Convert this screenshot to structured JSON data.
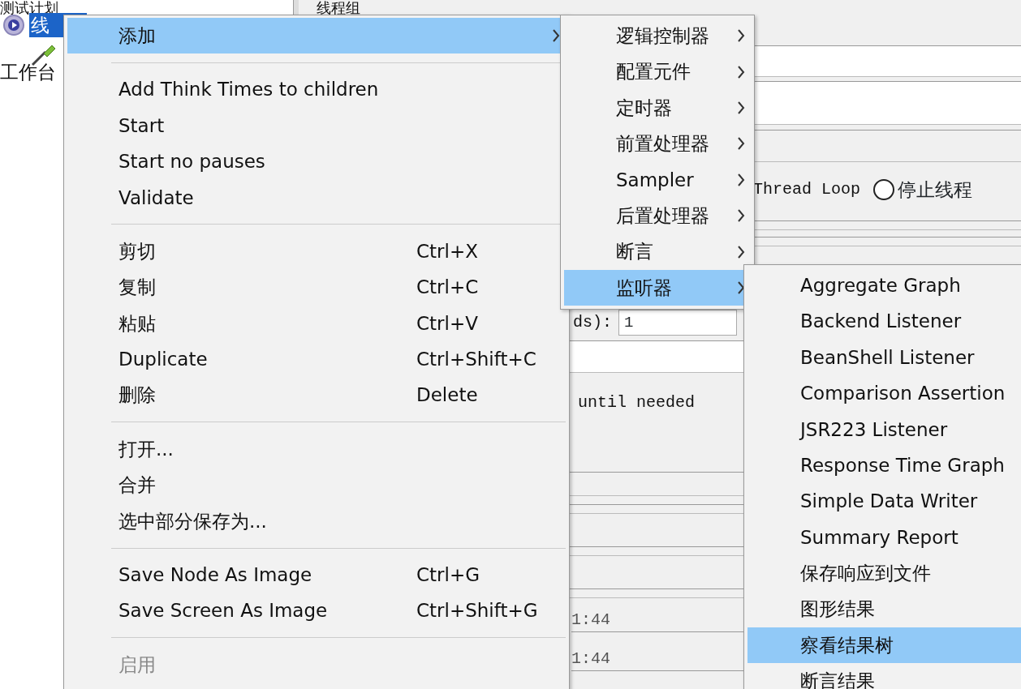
{
  "tree": {
    "items": [
      {
        "label": "测试计划",
        "kind": "plan",
        "selected": false
      },
      {
        "label": "线",
        "kind": "thread_group",
        "selected": true
      },
      {
        "label": "工作台",
        "kind": "workbench",
        "selected": false
      }
    ]
  },
  "panel": {
    "title": "线程组",
    "loop_label": "Thread Loop",
    "radio": {
      "label": "停止线程",
      "selected": false
    },
    "threads_label": "ds):",
    "threads_value": "1",
    "delay_note": "until needed",
    "times": [
      "1:44",
      "1:44"
    ]
  },
  "context_menu": {
    "items": [
      {
        "kind": "item",
        "label": "添加",
        "submenu": true,
        "selected": true,
        "disabled": false
      },
      {
        "kind": "separator"
      },
      {
        "kind": "item",
        "label": "Add Think Times to children",
        "selected": false,
        "disabled": false
      },
      {
        "kind": "item",
        "label": "Start",
        "selected": false,
        "disabled": false
      },
      {
        "kind": "item",
        "label": "Start no pauses",
        "selected": false,
        "disabled": false
      },
      {
        "kind": "item",
        "label": "Validate",
        "selected": false,
        "disabled": false
      },
      {
        "kind": "separator"
      },
      {
        "kind": "item",
        "label": "剪切",
        "shortcut": "Ctrl+X",
        "selected": false,
        "disabled": false
      },
      {
        "kind": "item",
        "label": "复制",
        "shortcut": "Ctrl+C",
        "selected": false,
        "disabled": false
      },
      {
        "kind": "item",
        "label": "粘贴",
        "shortcut": "Ctrl+V",
        "selected": false,
        "disabled": false
      },
      {
        "kind": "item",
        "label": "Duplicate",
        "shortcut": "Ctrl+Shift+C",
        "selected": false,
        "disabled": false
      },
      {
        "kind": "item",
        "label": "删除",
        "shortcut": "Delete",
        "selected": false,
        "disabled": false
      },
      {
        "kind": "separator"
      },
      {
        "kind": "item",
        "label": "打开...",
        "selected": false,
        "disabled": false
      },
      {
        "kind": "item",
        "label": "合并",
        "selected": false,
        "disabled": false
      },
      {
        "kind": "item",
        "label": "选中部分保存为...",
        "selected": false,
        "disabled": false
      },
      {
        "kind": "separator"
      },
      {
        "kind": "item",
        "label": "Save Node As Image",
        "shortcut": "Ctrl+G",
        "selected": false,
        "disabled": false
      },
      {
        "kind": "item",
        "label": "Save Screen As Image",
        "shortcut": "Ctrl+Shift+G",
        "selected": false,
        "disabled": false
      },
      {
        "kind": "separator"
      },
      {
        "kind": "item",
        "label": "启用",
        "selected": false,
        "disabled": true
      }
    ]
  },
  "add_submenu": {
    "items": [
      {
        "label": "逻辑控制器",
        "selected": false
      },
      {
        "label": "配置元件",
        "selected": false
      },
      {
        "label": "定时器",
        "selected": false
      },
      {
        "label": "前置处理器",
        "selected": false
      },
      {
        "label": "Sampler",
        "selected": false
      },
      {
        "label": "后置处理器",
        "selected": false
      },
      {
        "label": "断言",
        "selected": false
      },
      {
        "label": "监听器",
        "selected": true
      }
    ]
  },
  "listener_submenu": {
    "items": [
      {
        "label": "Aggregate Graph",
        "selected": false
      },
      {
        "label": "Backend Listener",
        "selected": false
      },
      {
        "label": "BeanShell Listener",
        "selected": false
      },
      {
        "label": "Comparison Assertion",
        "selected": false
      },
      {
        "label": "JSR223 Listener",
        "selected": false
      },
      {
        "label": "Response Time Graph",
        "selected": false
      },
      {
        "label": "Simple Data Writer",
        "selected": false
      },
      {
        "label": "Summary Report",
        "selected": false
      },
      {
        "label": "保存响应到文件",
        "selected": false
      },
      {
        "label": "图形结果",
        "selected": false
      },
      {
        "label": "察看结果树",
        "selected": true
      },
      {
        "label": "断言结果",
        "selected": false
      }
    ]
  }
}
